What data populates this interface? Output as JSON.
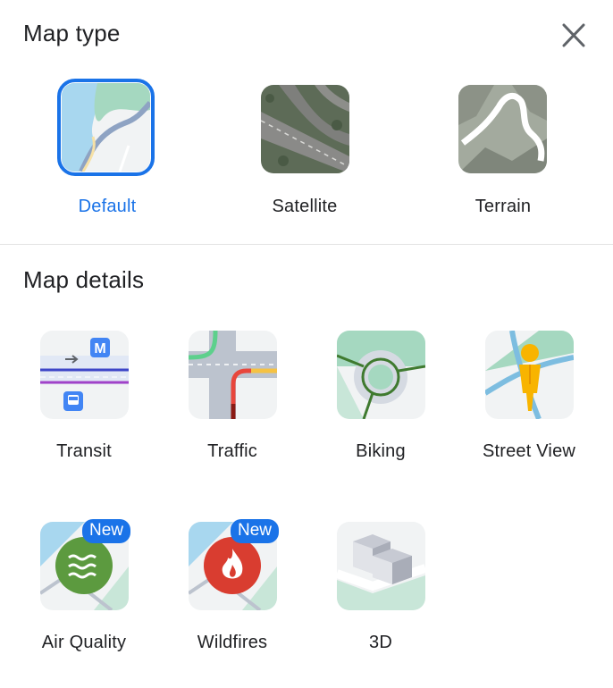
{
  "header": {
    "title": "Map type",
    "close_icon": "close-icon"
  },
  "map_types": [
    {
      "label": "Default",
      "selected": true,
      "icon": "default-map-thumbnail"
    },
    {
      "label": "Satellite",
      "selected": false,
      "icon": "satellite-map-thumbnail"
    },
    {
      "label": "Terrain",
      "selected": false,
      "icon": "terrain-map-thumbnail"
    }
  ],
  "details": {
    "title": "Map details",
    "items": [
      {
        "label": "Transit",
        "icon": "transit-thumbnail",
        "badge": ""
      },
      {
        "label": "Traffic",
        "icon": "traffic-thumbnail",
        "badge": ""
      },
      {
        "label": "Biking",
        "icon": "biking-thumbnail",
        "badge": ""
      },
      {
        "label": "Street View",
        "icon": "street-view-thumbnail",
        "badge": ""
      },
      {
        "label": "Air Quality",
        "icon": "air-quality-thumbnail",
        "badge": "New"
      },
      {
        "label": "Wildfires",
        "icon": "wildfires-thumbnail",
        "badge": "New"
      },
      {
        "label": "3D",
        "icon": "3d-thumbnail",
        "badge": ""
      }
    ]
  },
  "colors": {
    "accent": "#1a73e8",
    "divider": "#e3e3e3"
  }
}
